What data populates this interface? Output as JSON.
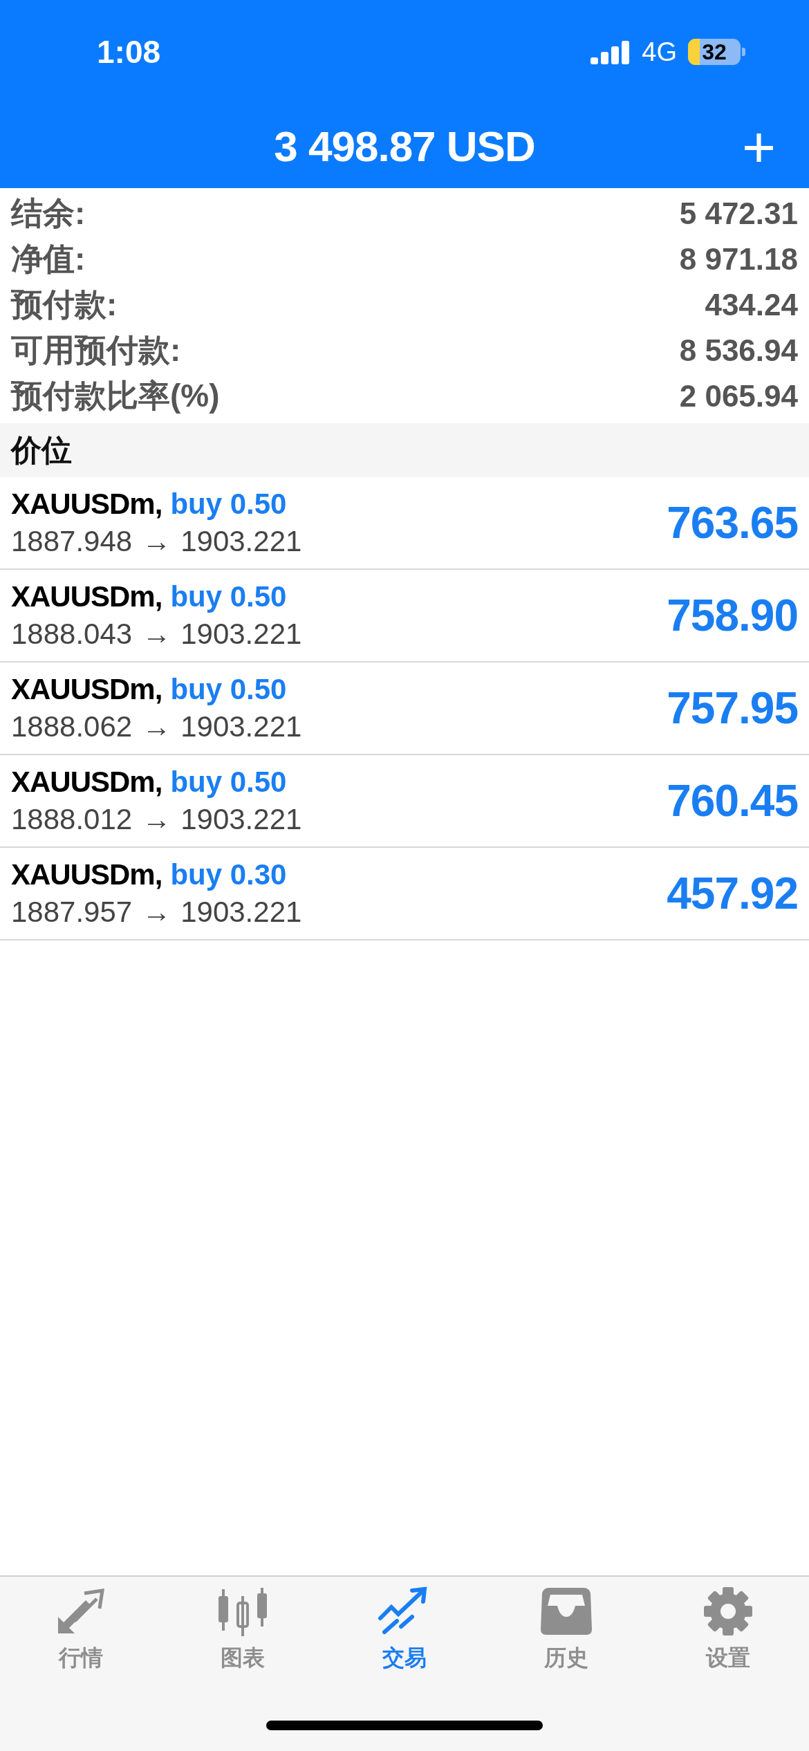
{
  "status_bar": {
    "time": "1:08",
    "network": "4G",
    "battery": "32"
  },
  "header": {
    "title": "3 498.87 USD",
    "add_button": "+"
  },
  "summary": [
    {
      "label": "结余:",
      "value": "5 472.31"
    },
    {
      "label": "净值:",
      "value": "8 971.18"
    },
    {
      "label": "预付款:",
      "value": "434.24"
    },
    {
      "label": "可用预付款:",
      "value": "8 536.94"
    },
    {
      "label": "预付款比率(%)",
      "value": "2 065.94"
    }
  ],
  "section_title": "价位",
  "positions": [
    {
      "symbol": "XAUUSDm,",
      "side": "buy 0.50",
      "open_price": "1887.948",
      "arrow": "→",
      "current_price": "1903.221",
      "profit": "763.65"
    },
    {
      "symbol": "XAUUSDm,",
      "side": "buy 0.50",
      "open_price": "1888.043",
      "arrow": "→",
      "current_price": "1903.221",
      "profit": "758.90"
    },
    {
      "symbol": "XAUUSDm,",
      "side": "buy 0.50",
      "open_price": "1888.062",
      "arrow": "→",
      "current_price": "1903.221",
      "profit": "757.95"
    },
    {
      "symbol": "XAUUSDm,",
      "side": "buy 0.50",
      "open_price": "1888.012",
      "arrow": "→",
      "current_price": "1903.221",
      "profit": "760.45"
    },
    {
      "symbol": "XAUUSDm,",
      "side": "buy 0.30",
      "open_price": "1887.957",
      "arrow": "→",
      "current_price": "1903.221",
      "profit": "457.92"
    }
  ],
  "tabs": [
    {
      "label": "行情",
      "selected": false
    },
    {
      "label": "图表",
      "selected": false
    },
    {
      "label": "交易",
      "selected": true
    },
    {
      "label": "历史",
      "selected": false
    },
    {
      "label": "设置",
      "selected": false
    }
  ]
}
